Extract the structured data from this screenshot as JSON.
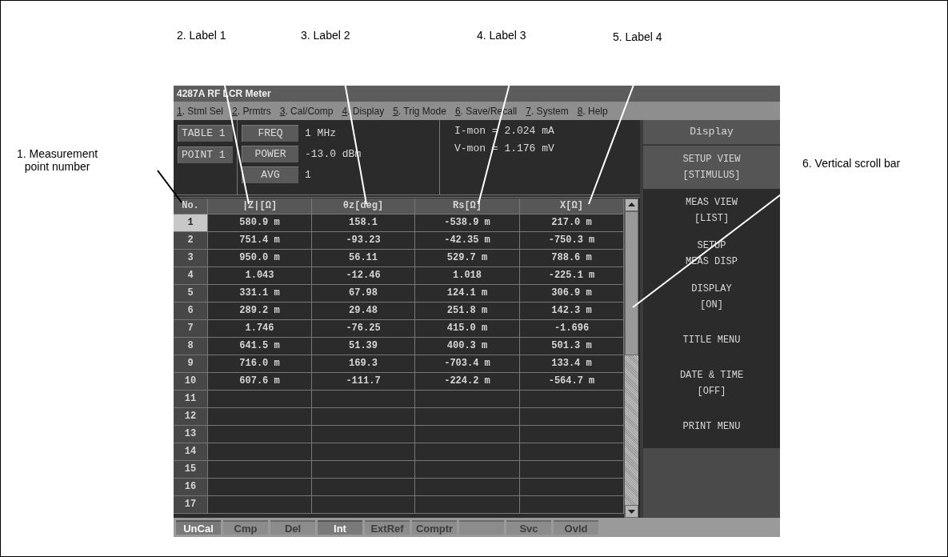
{
  "window": {
    "title": "4287A RF LCR Meter"
  },
  "menu": [
    {
      "label": "1. Stml Sel"
    },
    {
      "label": "2. Prmtrs"
    },
    {
      "label": "3. Cal/Comp"
    },
    {
      "label": "4. Display"
    },
    {
      "label": "5. Trig Mode"
    },
    {
      "label": "6. Save/Recall"
    },
    {
      "label": "7. System"
    },
    {
      "label": "8. Help"
    }
  ],
  "info": {
    "tags": [
      "TABLE 1",
      "POINT 1"
    ],
    "settings": [
      {
        "label": "FREQ",
        "value": "1 MHz"
      },
      {
        "label": "POWER",
        "value": "-13.0 dBm"
      },
      {
        "label": "AVG",
        "value": "1"
      }
    ],
    "monitors": [
      "I-mon = 2.024 mA",
      "V-mon = 1.176 mV"
    ]
  },
  "table": {
    "columns": [
      "No.",
      "|Z|[Ω]",
      "θz[deg]",
      "Rs[Ω]",
      "X[Ω]"
    ],
    "rows": [
      {
        "no": "1",
        "selected": true,
        "cells": [
          "580.9 m",
          "158.1",
          "-538.9 m",
          "217.0 m"
        ]
      },
      {
        "no": "2",
        "selected": false,
        "cells": [
          "751.4 m",
          "-93.23",
          "-42.35 m",
          "-750.3 m"
        ]
      },
      {
        "no": "3",
        "selected": false,
        "cells": [
          "950.0 m",
          "56.11",
          "529.7 m",
          "788.6 m"
        ]
      },
      {
        "no": "4",
        "selected": false,
        "cells": [
          "1.043",
          "-12.46",
          "1.018",
          "-225.1 m"
        ]
      },
      {
        "no": "5",
        "selected": false,
        "cells": [
          "331.1 m",
          "67.98",
          "124.1 m",
          "306.9 m"
        ]
      },
      {
        "no": "6",
        "selected": false,
        "cells": [
          "289.2 m",
          "29.48",
          "251.8 m",
          "142.3 m"
        ]
      },
      {
        "no": "7",
        "selected": false,
        "cells": [
          "1.746",
          "-76.25",
          "415.0 m",
          "-1.696"
        ]
      },
      {
        "no": "8",
        "selected": false,
        "cells": [
          "641.5 m",
          "51.39",
          "400.3 m",
          "501.3 m"
        ]
      },
      {
        "no": "9",
        "selected": false,
        "cells": [
          "716.0 m",
          "169.3",
          "-703.4 m",
          "133.4 m"
        ]
      },
      {
        "no": "10",
        "selected": false,
        "cells": [
          "607.6 m",
          "-111.7",
          "-224.2 m",
          "-564.7 m"
        ]
      },
      {
        "no": "11",
        "selected": false
      },
      {
        "no": "12",
        "selected": false
      },
      {
        "no": "13",
        "selected": false
      },
      {
        "no": "14",
        "selected": false
      },
      {
        "no": "15",
        "selected": false
      },
      {
        "no": "16",
        "selected": false
      },
      {
        "no": "17",
        "selected": false
      }
    ]
  },
  "softkeys": {
    "title": "Display",
    "items": [
      {
        "lines": [
          "SETUP VIEW",
          "[STIMULUS]"
        ],
        "selected": true
      },
      {
        "lines": [
          "MEAS VIEW",
          "[LIST]"
        ],
        "selected": false
      },
      {
        "lines": [
          "SETUP",
          "MEAS DISP"
        ],
        "selected": false
      },
      {
        "lines": [
          "DISPLAY",
          "[ON]"
        ],
        "selected": false
      },
      {
        "lines": [
          "TITLE MENU"
        ],
        "selected": false
      },
      {
        "lines": [
          "DATE & TIME",
          "[OFF]"
        ],
        "selected": false
      },
      {
        "lines": [
          "PRINT MENU"
        ],
        "selected": false
      }
    ]
  },
  "status_bar": [
    {
      "label": "UnCal",
      "on": true
    },
    {
      "label": "Cmp",
      "on": false
    },
    {
      "label": "Del",
      "on": false
    },
    {
      "label": "Int",
      "on": true
    },
    {
      "label": "ExtRef",
      "on": false
    },
    {
      "label": "Comptr",
      "on": false
    },
    {
      "on": false
    },
    {
      "label": "Svc",
      "on": false
    },
    {
      "label": "Ovld",
      "on": false
    }
  ],
  "callouts": [
    {
      "text": "1. Measurement\npoint number"
    },
    {
      "text": "2. Label 1"
    },
    {
      "text": "3. Label 2"
    },
    {
      "text": "4. Label 3"
    },
    {
      "text": "5. Label 4"
    },
    {
      "text": "6. Vertical scroll bar"
    }
  ]
}
